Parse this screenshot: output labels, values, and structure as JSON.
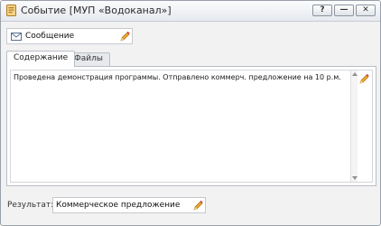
{
  "window": {
    "title": "Событие [МУП «Водоканал»]",
    "buttons": {
      "help": "?",
      "minimize": "—",
      "close": "✕"
    }
  },
  "subject": {
    "value": "Сообщение",
    "icon": "mail-icon",
    "edit_icon": "pencil-icon"
  },
  "tabs": [
    {
      "label": "Содержание",
      "active": true
    },
    {
      "label": "Файлы",
      "active": false
    }
  ],
  "content": {
    "text": "Проведена демонстрация программы. Отправлено коммерч. предложение на 10 р.м.",
    "edit_icon": "pencil-icon"
  },
  "result": {
    "label": "Результат:",
    "value": "Коммерческое предложение",
    "edit_icon": "pencil-icon"
  },
  "colors": {
    "pencil": "#e8a020",
    "title_bar": "#e6e9ee",
    "panel_border": "#b9bec6"
  }
}
